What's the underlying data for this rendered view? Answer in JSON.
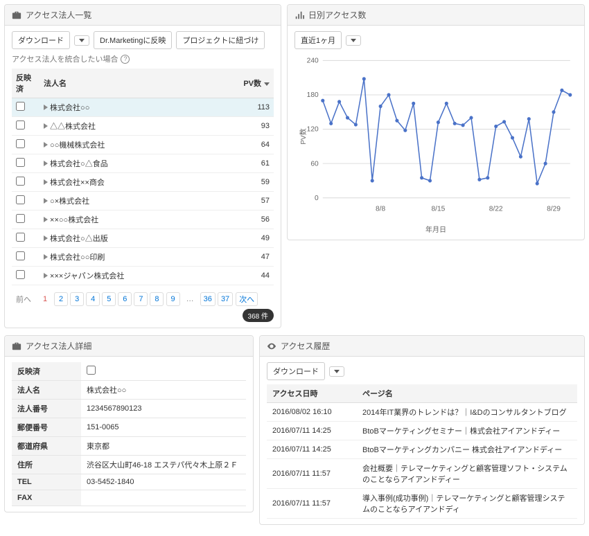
{
  "company_list": {
    "title": "アクセス法人一覧",
    "buttons": {
      "download": "ダウンロード",
      "dr_marketing": "Dr.Marketingに反映",
      "project_link": "プロジェクトに紐づけ"
    },
    "help_text": "アクセス法人を統合したい場合",
    "columns": {
      "reflected": "反映済",
      "company": "法人名",
      "pv": "PV数"
    },
    "rows": [
      {
        "company": "株式会社○○",
        "pv": 113,
        "highlight": true
      },
      {
        "company": "△△株式会社",
        "pv": 93
      },
      {
        "company": "○○機械株式会社",
        "pv": 64
      },
      {
        "company": "株式会社○△食品",
        "pv": 61
      },
      {
        "company": "株式会社××商会",
        "pv": 59
      },
      {
        "company": "○×株式会社",
        "pv": 57
      },
      {
        "company": "××○○株式会社",
        "pv": 56
      },
      {
        "company": "株式会社○△出版",
        "pv": 49
      },
      {
        "company": "株式会社○○印刷",
        "pv": 47
      },
      {
        "company": "×××ジャパン株式会社",
        "pv": 44
      }
    ],
    "pagination": {
      "prev": "前へ",
      "next": "次へ",
      "pages_shown": [
        "1",
        "2",
        "3",
        "4",
        "5",
        "6",
        "7",
        "8",
        "9",
        "…",
        "36",
        "37"
      ],
      "active": "1",
      "total_label": "368 件"
    }
  },
  "daily_access": {
    "title": "日別アクセス数",
    "range_label": "直近1ヶ月"
  },
  "chart_data": {
    "type": "line",
    "title": "",
    "xlabel": "年月日",
    "ylabel": "PV数",
    "ylim": [
      0,
      240
    ],
    "yticks": [
      0,
      60,
      120,
      180,
      240
    ],
    "xticks": [
      "8/8",
      "8/15",
      "8/22",
      "8/29"
    ],
    "x": [
      "8/1",
      "8/2",
      "8/3",
      "8/4",
      "8/5",
      "8/6",
      "8/7",
      "8/8",
      "8/9",
      "8/10",
      "8/11",
      "8/12",
      "8/13",
      "8/14",
      "8/15",
      "8/16",
      "8/17",
      "8/18",
      "8/19",
      "8/20",
      "8/21",
      "8/22",
      "8/23",
      "8/24",
      "8/25",
      "8/26",
      "8/27",
      "8/28",
      "8/29",
      "8/30",
      "8/31"
    ],
    "values": [
      170,
      130,
      168,
      140,
      128,
      208,
      30,
      160,
      180,
      135,
      118,
      165,
      35,
      30,
      132,
      165,
      130,
      127,
      140,
      32,
      35,
      125,
      133,
      105,
      72,
      138,
      25,
      60,
      150,
      188,
      180
    ]
  },
  "company_detail": {
    "title": "アクセス法人詳細",
    "rows": [
      {
        "label": "反映済",
        "value": ""
      },
      {
        "label": "法人名",
        "value": "株式会社○○"
      },
      {
        "label": "法人番号",
        "value": "1234567890123"
      },
      {
        "label": "郵便番号",
        "value": "151-0065"
      },
      {
        "label": "都道府県",
        "value": "東京都"
      },
      {
        "label": "住所",
        "value": "渋谷区大山町46-18 エステパ代々木上原２Ｆ"
      },
      {
        "label": "TEL",
        "value": "03-5452-1840"
      },
      {
        "label": "FAX",
        "value": ""
      }
    ]
  },
  "access_history": {
    "title": "アクセス履歴",
    "download": "ダウンロード",
    "columns": {
      "datetime": "アクセス日時",
      "page": "ページ名"
    },
    "rows": [
      {
        "datetime": "2016/08/02 16:10",
        "page": "2014年IT業界のトレンドは？｜I&Dのコンサルタントブログ"
      },
      {
        "datetime": "2016/07/11 14:25",
        "page": "BtoBマーケティングセミナー｜株式会社アイアンドディー"
      },
      {
        "datetime": "2016/07/11 14:25",
        "page": "BtoBマーケティングカンパニー 株式会社アイアンドディー"
      },
      {
        "datetime": "2016/07/11 11:57",
        "page": "会社概要｜テレマーケティングと顧客管理ソフト・システムのことならアイアンドディー"
      },
      {
        "datetime": "2016/07/11 11:57",
        "page": "導入事例(成功事例)｜テレマーケティングと顧客管理システムのことならアイアンドディ"
      }
    ]
  }
}
